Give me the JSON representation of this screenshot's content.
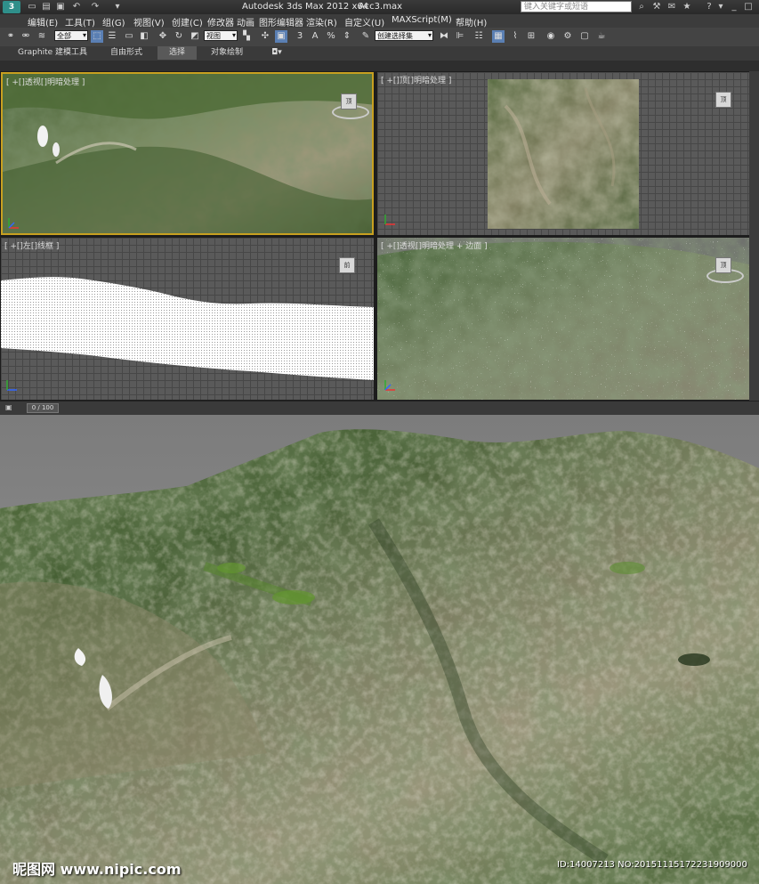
{
  "title_bar": {
    "app_title": "Autodesk 3ds Max  2012 x64",
    "file_name": "Acc3.max",
    "search_placeholder": "键入关键字或短语",
    "logo_text": "3"
  },
  "menu": [
    {
      "label": "编辑(E)"
    },
    {
      "label": "工具(T)"
    },
    {
      "label": "组(G)"
    },
    {
      "label": "视图(V)"
    },
    {
      "label": "创建(C)"
    },
    {
      "label": "修改器"
    },
    {
      "label": "动画"
    },
    {
      "label": "图形编辑器"
    },
    {
      "label": "渲染(R)"
    },
    {
      "label": "自定义(U)"
    },
    {
      "label": "MAXScript(M)"
    },
    {
      "label": "帮助(H)"
    }
  ],
  "toolbar": {
    "selection_filter": "全部",
    "reference_coord": "视图",
    "named_selection": "创建选择集",
    "snap_label": "3",
    "angle_snap_label": "A",
    "percent_snap_label": "%"
  },
  "ribbon": {
    "tabs": [
      {
        "label": "Graphite 建模工具"
      },
      {
        "label": "自由形式"
      },
      {
        "label": "选择"
      },
      {
        "label": "对象绘制"
      }
    ],
    "active_tab": "选择"
  },
  "viewports": [
    {
      "id": "top-left",
      "label": "[ +[]透视[]明暗处理 ]"
    },
    {
      "id": "top-right",
      "label": "[ +[]顶[]明暗处理 ]"
    },
    {
      "id": "bottom-left",
      "label": "[ +[]左[]线框 ]"
    },
    {
      "id": "bottom-right",
      "label": "[ +[]透视[]明暗处理 + 边面 ]"
    }
  ],
  "viewcube": {
    "top": "顶",
    "front": "前"
  },
  "timeline": {
    "frame_display": "0 / 100",
    "progress": 0
  },
  "watermark": {
    "logo": "昵图网 www.nipic.com",
    "id_text": "ID:14007213 NO:20151115172231909000"
  },
  "colors": {
    "terrain_dark": "#2f4a25",
    "terrain_mid": "#5f7a4a",
    "terrain_light": "#a89a80",
    "sky": "#8a8a8a",
    "grid": "#5a5a5a"
  }
}
